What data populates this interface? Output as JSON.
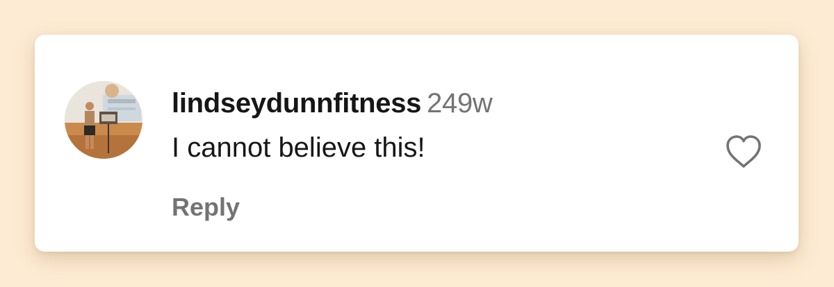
{
  "comment": {
    "username": "lindseydunnfitness",
    "timestamp": "249w",
    "text": "I cannot believe this!",
    "reply_label": "Reply"
  },
  "icons": {
    "avatar": "user-avatar-photo",
    "like": "heart-outline-icon"
  },
  "colors": {
    "page_background": "#fdebd3",
    "card_background": "#ffffff",
    "primary_text": "#161616",
    "secondary_text": "#737373"
  }
}
